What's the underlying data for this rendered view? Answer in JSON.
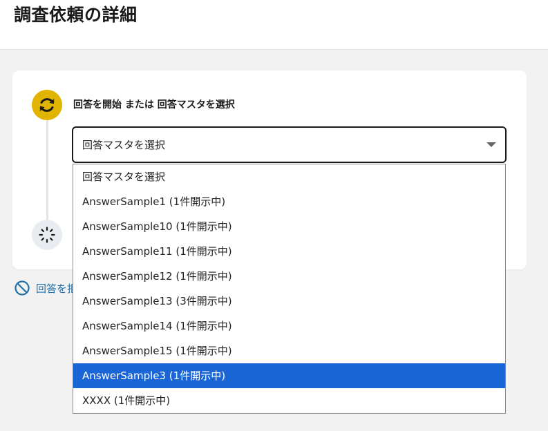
{
  "page": {
    "title": "調査依頼の詳細"
  },
  "step": {
    "label": "回答を開始 または 回答マスタを選択",
    "active_icon": "refresh-icon",
    "pending_icon": "loading-spinner-icon",
    "active_color": "#e0b400"
  },
  "select": {
    "value": "回答マスタを選択",
    "options": [
      {
        "label": "回答マスタを選択",
        "selected": false
      },
      {
        "label": "AnswerSample1 (1件開示中)",
        "selected": false
      },
      {
        "label": "AnswerSample10 (1件開示中)",
        "selected": false
      },
      {
        "label": "AnswerSample11 (1件開示中)",
        "selected": false
      },
      {
        "label": "AnswerSample12 (1件開示中)",
        "selected": false
      },
      {
        "label": "AnswerSample13 (3件開示中)",
        "selected": false
      },
      {
        "label": "AnswerSample14 (1件開示中)",
        "selected": false
      },
      {
        "label": "AnswerSample15 (1件開示中)",
        "selected": false
      },
      {
        "label": "AnswerSample3 (1件開示中)",
        "selected": true
      },
      {
        "label": "XXXX (1件開示中)",
        "selected": false
      }
    ],
    "highlight_color": "#1a66d6"
  },
  "cancel": {
    "label": "回答を拒否",
    "icon": "no-entry-icon",
    "color": "#1f6fa8"
  }
}
